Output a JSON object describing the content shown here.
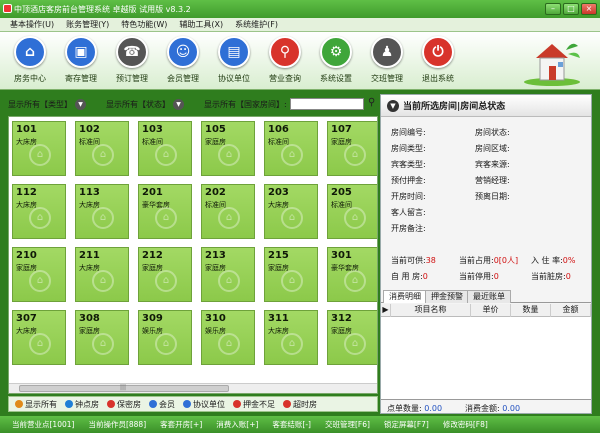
{
  "window": {
    "title": "中顶酒店客房前台管理系统 卓越版 试用版 v8.3.2",
    "min": "–",
    "max": "□",
    "close": "×"
  },
  "menu": [
    "基本操作(U)",
    "账务管理(Y)",
    "特色功能(W)",
    "辅助工具(X)",
    "系统维护(F)"
  ],
  "toolbar": [
    {
      "label": "房务中心",
      "icon": "house-icon",
      "color": "#2f6fd6",
      "glyph": "⌂"
    },
    {
      "label": "寄存管理",
      "icon": "bag-icon",
      "color": "#2f6fd6",
      "glyph": "▣"
    },
    {
      "label": "预订管理",
      "icon": "phone-icon",
      "color": "#555555",
      "glyph": "☎"
    },
    {
      "label": "会员管理",
      "icon": "user-icon",
      "color": "#2f6fd6",
      "glyph": "☺"
    },
    {
      "label": "协议单位",
      "icon": "document-icon",
      "color": "#2f6fd6",
      "glyph": "▤"
    },
    {
      "label": "营业查询",
      "icon": "magnifier-icon",
      "color": "#d8332b",
      "glyph": "⚲"
    },
    {
      "label": "系统设置",
      "icon": "gear-icon",
      "color": "#3fa63a",
      "glyph": "⚙"
    },
    {
      "label": "交班管理",
      "icon": "people-icon",
      "color": "#555555",
      "glyph": "♟"
    },
    {
      "label": "退出系统",
      "icon": "power-icon",
      "color": "#d8332b",
      "glyph": "⏻"
    }
  ],
  "filters": {
    "type": "显示所有【类型】",
    "status": "显示所有【状态】",
    "search_label": "显示所有【国家房间】:",
    "search_value": ""
  },
  "rooms": [
    {
      "no": "101",
      "type": "大床房"
    },
    {
      "no": "102",
      "type": "标准间"
    },
    {
      "no": "103",
      "type": "标准间"
    },
    {
      "no": "105",
      "type": "家庭房"
    },
    {
      "no": "106",
      "type": "标准间"
    },
    {
      "no": "107",
      "type": "家庭房"
    },
    {
      "no": "112",
      "type": "大床房"
    },
    {
      "no": "113",
      "type": "大床房"
    },
    {
      "no": "201",
      "type": "豪华套房"
    },
    {
      "no": "202",
      "type": "标准间"
    },
    {
      "no": "203",
      "type": "大床房"
    },
    {
      "no": "205",
      "type": "标准间"
    },
    {
      "no": "210",
      "type": "家庭房"
    },
    {
      "no": "211",
      "type": "大床房"
    },
    {
      "no": "212",
      "type": "家庭房"
    },
    {
      "no": "213",
      "type": "家庭房"
    },
    {
      "no": "215",
      "type": "家庭房"
    },
    {
      "no": "301",
      "type": "豪华套房"
    },
    {
      "no": "307",
      "type": "大床房"
    },
    {
      "no": "308",
      "type": "家庭房"
    },
    {
      "no": "309",
      "type": "娱乐房"
    },
    {
      "no": "310",
      "type": "娱乐房"
    },
    {
      "no": "311",
      "type": "大床房"
    },
    {
      "no": "312",
      "type": "家庭房"
    }
  ],
  "legend": [
    {
      "label": "显示所有",
      "color": "#e08a1a"
    },
    {
      "label": "钟点房",
      "color": "#1f7fd6"
    },
    {
      "label": "保密房",
      "color": "#d8332b"
    },
    {
      "label": "会员",
      "color": "#2f6fd6"
    },
    {
      "label": "协议单位",
      "color": "#2f6fd6"
    },
    {
      "label": "押金不足",
      "color": "#d8332b"
    },
    {
      "label": "超时房",
      "color": "#d8332b"
    }
  ],
  "right": {
    "header": "当前所选房间|房间总状态",
    "fields_left": [
      "房间编号:",
      "房间类型:",
      "宾客类型:",
      "预付押金:",
      "开房时间:",
      "客人留言:",
      "开房备注:"
    ],
    "fields_right": [
      "房间状态:",
      "房间区域:",
      "宾客来源:",
      "营销经理:",
      "预离日期:"
    ],
    "stats": {
      "available_label": "当前可供:",
      "available": "38",
      "occupied_label": "当前占用:",
      "occupied": "0[0人]",
      "occupancy_label": "入 住 率:",
      "occupancy": "0%",
      "self_use_label": "自 用 房:",
      "self_use": "0",
      "stopped_label": "当前停用:",
      "stopped": "0",
      "dirty_label": "当前脏房:",
      "dirty": "0"
    },
    "tabs": [
      "消费明细",
      "押金预警",
      "最近账单"
    ],
    "columns": [
      "项目名称",
      "单价",
      "数量",
      "金额"
    ],
    "footer": {
      "count_label": "点单数量:",
      "count": "0.00",
      "amount_label": "消费金额:",
      "amount": "0.00"
    }
  },
  "status": [
    "当前营业点[1001]",
    "当前操作员[888]",
    "客套开房[+]",
    "消费入账[+]",
    "客套结账[-]",
    "交班管理[F6]",
    "锁定屏幕[F7]",
    "修改密码[F8]"
  ]
}
